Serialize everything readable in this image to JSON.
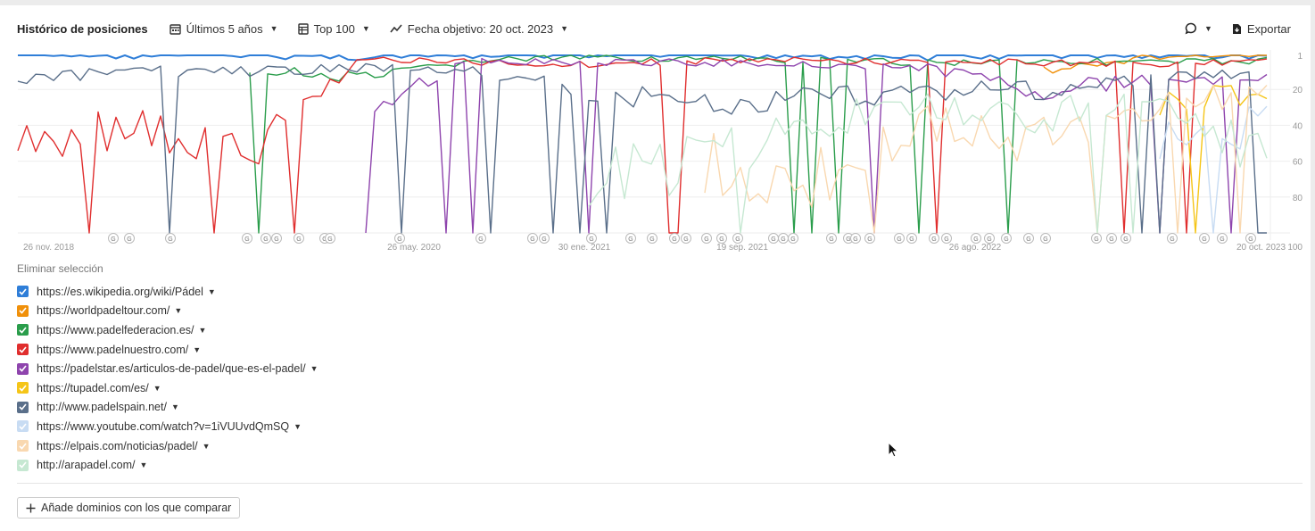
{
  "toolbar": {
    "title": "Histórico de posiciones",
    "period": "Últimos 5 años",
    "top": "Top 100",
    "target_date": "Fecha objetivo: 20 oct. 2023",
    "export": "Exportar"
  },
  "legend": {
    "clear_label": "Eliminar selección",
    "items": [
      {
        "url": "https://es.wikipedia.org/wiki/Pádel",
        "color": "#2f7ed8"
      },
      {
        "url": "https://worldpadeltour.com/",
        "color": "#f0900a"
      },
      {
        "url": "https://www.padelfederacion.es/",
        "color": "#2a9d4b"
      },
      {
        "url": "https://www.padelnuestro.com/",
        "color": "#e02e2e"
      },
      {
        "url": "https://padelstar.es/articulos-de-padel/que-es-el-padel/",
        "color": "#8e44ad"
      },
      {
        "url": "https://tupadel.com/es/",
        "color": "#f5c518"
      },
      {
        "url": "http://www.padelspain.net/",
        "color": "#5a6f8a"
      },
      {
        "url": "https://www.youtube.com/watch?v=1iVUUvdQmSQ",
        "color": "#c8dcf3"
      },
      {
        "url": "https://elpais.com/noticias/padel/",
        "color": "#f9d8b0"
      },
      {
        "url": "http://arapadel.com/",
        "color": "#c6e8d2"
      }
    ]
  },
  "add_button": "Añade dominios con los que comparar",
  "chart_data": {
    "type": "line",
    "title": "",
    "xlabel": "",
    "ylabel": "",
    "y_inverted": true,
    "ylim": [
      1,
      100
    ],
    "y_ticks": [
      "1",
      "20",
      "40",
      "60",
      "80",
      "100"
    ],
    "x_ticks": [
      "26 nov. 2018",
      "26 may. 2020",
      "30 ene. 2021",
      "19 sep. 2021",
      "26 ago. 2022",
      "20 oct. 2023"
    ],
    "annotation_markers": "G",
    "series": [
      {
        "name": "https://es.wikipedia.org/wiki/Pádel",
        "values": [
          1,
          1,
          1,
          2,
          1,
          1,
          1,
          1,
          2,
          1,
          1,
          1
        ]
      },
      {
        "name": "https://worldpadeltour.com/",
        "values": [
          null,
          null,
          null,
          null,
          null,
          null,
          null,
          null,
          null,
          10,
          2,
          1
        ]
      },
      {
        "name": "https://www.padelfederacion.es/",
        "values": [
          null,
          null,
          8,
          15,
          4,
          2,
          3,
          4,
          5,
          4,
          5,
          4
        ]
      },
      {
        "name": "https://www.padelnuestro.com/",
        "values": [
          50,
          40,
          60,
          3,
          5,
          6,
          4,
          4,
          5,
          5,
          6,
          5
        ]
      },
      {
        "name": "https://padelstar.es/articulos-de-padel/que-es-el-padel/",
        "values": [
          null,
          null,
          null,
          30,
          4,
          5,
          5,
          6,
          8,
          20,
          15,
          12
        ]
      },
      {
        "name": "https://tupadel.com/es/",
        "values": [
          null,
          null,
          null,
          null,
          null,
          null,
          null,
          null,
          null,
          null,
          30,
          20
        ]
      },
      {
        "name": "http://www.padelspain.net/",
        "values": [
          15,
          10,
          10,
          8,
          10,
          20,
          30,
          25,
          20,
          20,
          15,
          10
        ]
      },
      {
        "name": "https://www.youtube.com/watch?v=1iVUUvdQmSQ",
        "values": [
          null,
          null,
          null,
          null,
          null,
          null,
          null,
          null,
          null,
          null,
          50,
          40
        ]
      },
      {
        "name": "https://elpais.com/noticias/padel/",
        "values": [
          null,
          null,
          null,
          null,
          null,
          null,
          60,
          70,
          40,
          50,
          30,
          20
        ]
      },
      {
        "name": "http://arapadel.com/",
        "values": [
          null,
          null,
          null,
          null,
          null,
          70,
          60,
          40,
          30,
          35,
          25,
          60
        ]
      }
    ]
  }
}
